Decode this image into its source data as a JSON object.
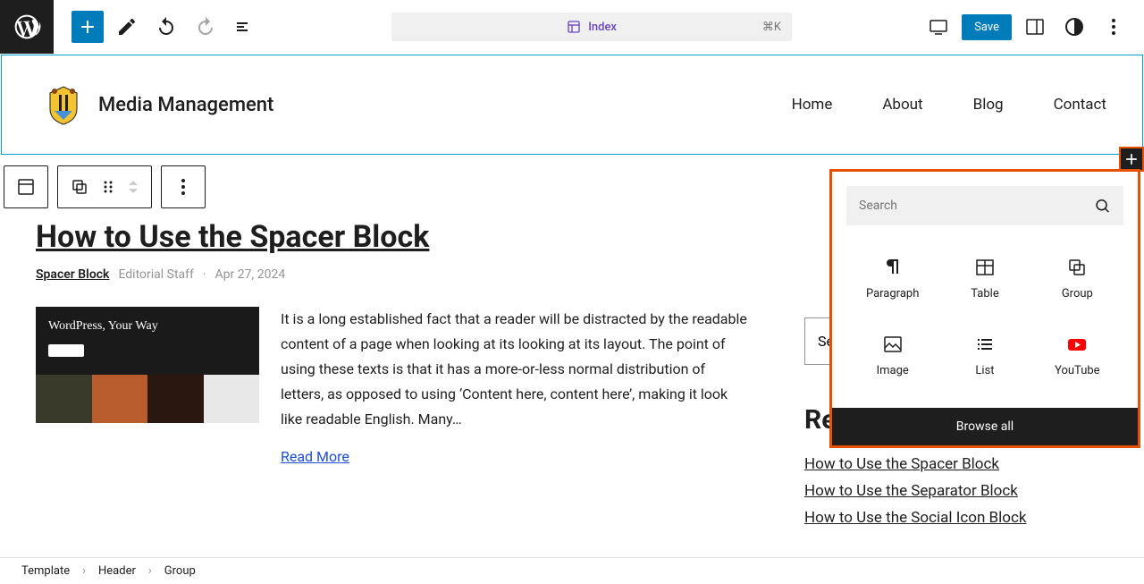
{
  "topbar": {
    "doc_label": "Index",
    "shortcut": "⌘K",
    "save": "Save"
  },
  "site": {
    "title": "Media Management",
    "nav": [
      "Home",
      "About",
      "Blog",
      "Contact"
    ]
  },
  "post": {
    "title": "How to Use the Spacer Block",
    "category": "Spacer Block",
    "author": "Editorial Staff",
    "date": "Apr 27, 2024",
    "hero_text": "WordPress, Your Way",
    "excerpt": "It is a long established fact that a reader will be distracted by the readable content of a page when looking at its looking at its layout. The point of using these texts is that it has a more-or-less normal distribution of letters, as opposed to using ‘Content here, content here’, making it look like readable English. Many…",
    "read_more": "Read More"
  },
  "sidebar": {
    "search_heading": "Se",
    "search_placeholder": "Se",
    "recent_heading": "Recent Posts",
    "recent": [
      "How to Use the Spacer Block",
      "How to Use the Separator Block",
      "How to Use the Social Icon Block"
    ]
  },
  "inserter": {
    "search_placeholder": "Search",
    "items": [
      "Paragraph",
      "Table",
      "Group",
      "Image",
      "List",
      "YouTube"
    ],
    "footer": "Browse all"
  },
  "breadcrumb": [
    "Template",
    "Header",
    "Group"
  ]
}
